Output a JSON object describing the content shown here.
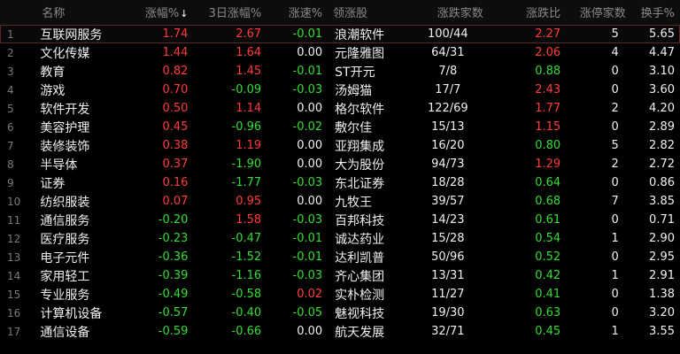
{
  "header": {
    "name": "名称",
    "pct": "涨幅%",
    "sort_arrow": "↓",
    "pct3d": "3日涨幅%",
    "speed": "涨速%",
    "lead": "领涨股",
    "updown": "涨跌家数",
    "ratio": "涨跌比",
    "limit": "涨停家数",
    "turnover": "换手%"
  },
  "colors": {
    "up": "#ff3b3b",
    "down": "#33dd33",
    "flat": "#f0f0f0"
  },
  "rows": [
    {
      "idx": "1",
      "name": "互联网服务",
      "pct": "1.74",
      "pct3d": "2.67",
      "speed": "-0.01",
      "lead": "浪潮软件",
      "updown": "100/44",
      "ratio": "2.27",
      "limit": "5",
      "turnover": "5.65"
    },
    {
      "idx": "2",
      "name": "文化传媒",
      "pct": "1.44",
      "pct3d": "1.64",
      "speed": "0.00",
      "lead": "元隆雅图",
      "updown": "64/31",
      "ratio": "2.06",
      "limit": "4",
      "turnover": "4.47"
    },
    {
      "idx": "3",
      "name": "教育",
      "pct": "0.82",
      "pct3d": "1.45",
      "speed": "-0.01",
      "lead": "ST开元",
      "updown": "7/8",
      "ratio": "0.88",
      "limit": "0",
      "turnover": "3.10"
    },
    {
      "idx": "4",
      "name": "游戏",
      "pct": "0.70",
      "pct3d": "-0.09",
      "speed": "-0.03",
      "lead": "汤姆猫",
      "updown": "17/7",
      "ratio": "2.43",
      "limit": "0",
      "turnover": "3.60"
    },
    {
      "idx": "5",
      "name": "软件开发",
      "pct": "0.50",
      "pct3d": "1.14",
      "speed": "0.00",
      "lead": "格尔软件",
      "updown": "122/69",
      "ratio": "1.77",
      "limit": "2",
      "turnover": "4.20"
    },
    {
      "idx": "6",
      "name": "美容护理",
      "pct": "0.45",
      "pct3d": "-0.96",
      "speed": "-0.02",
      "lead": "敷尔佳",
      "updown": "15/13",
      "ratio": "1.15",
      "limit": "0",
      "turnover": "2.89"
    },
    {
      "idx": "7",
      "name": "装修装饰",
      "pct": "0.38",
      "pct3d": "1.19",
      "speed": "0.00",
      "lead": "亚翔集成",
      "updown": "16/20",
      "ratio": "0.80",
      "limit": "5",
      "turnover": "2.82"
    },
    {
      "idx": "8",
      "name": "半导体",
      "pct": "0.37",
      "pct3d": "-1.90",
      "speed": "0.00",
      "lead": "大为股份",
      "updown": "94/73",
      "ratio": "1.29",
      "limit": "2",
      "turnover": "2.72"
    },
    {
      "idx": "9",
      "name": "证券",
      "pct": "0.16",
      "pct3d": "-1.77",
      "speed": "-0.03",
      "lead": "东北证券",
      "updown": "18/28",
      "ratio": "0.64",
      "limit": "0",
      "turnover": "0.86"
    },
    {
      "idx": "10",
      "name": "纺织服装",
      "pct": "0.07",
      "pct3d": "0.95",
      "speed": "0.00",
      "lead": "九牧王",
      "updown": "39/57",
      "ratio": "0.68",
      "limit": "7",
      "turnover": "3.85"
    },
    {
      "idx": "11",
      "name": "通信服务",
      "pct": "-0.20",
      "pct3d": "1.58",
      "speed": "-0.03",
      "lead": "百邦科技",
      "updown": "14/23",
      "ratio": "0.61",
      "limit": "0",
      "turnover": "0.71"
    },
    {
      "idx": "12",
      "name": "医疗服务",
      "pct": "-0.23",
      "pct3d": "-0.47",
      "speed": "-0.01",
      "lead": "诚达药业",
      "updown": "15/28",
      "ratio": "0.54",
      "limit": "1",
      "turnover": "2.90"
    },
    {
      "idx": "13",
      "name": "电子元件",
      "pct": "-0.36",
      "pct3d": "-1.52",
      "speed": "-0.01",
      "lead": "达利凯普",
      "updown": "50/96",
      "ratio": "0.52",
      "limit": "0",
      "turnover": "2.95"
    },
    {
      "idx": "14",
      "name": "家用轻工",
      "pct": "-0.39",
      "pct3d": "-1.16",
      "speed": "-0.03",
      "lead": "齐心集团",
      "updown": "13/31",
      "ratio": "0.42",
      "limit": "1",
      "turnover": "2.91"
    },
    {
      "idx": "15",
      "name": "专业服务",
      "pct": "-0.49",
      "pct3d": "-0.58",
      "speed": "0.02",
      "lead": "实朴检测",
      "updown": "11/27",
      "ratio": "0.41",
      "limit": "0",
      "turnover": "1.38"
    },
    {
      "idx": "16",
      "name": "计算机设备",
      "pct": "-0.57",
      "pct3d": "-0.40",
      "speed": "-0.05",
      "lead": "魅视科技",
      "updown": "19/30",
      "ratio": "0.63",
      "limit": "0",
      "turnover": "3.20"
    },
    {
      "idx": "17",
      "name": "通信设备",
      "pct": "-0.59",
      "pct3d": "-0.66",
      "speed": "0.00",
      "lead": "航天发展",
      "updown": "32/71",
      "ratio": "0.45",
      "limit": "1",
      "turnover": "3.55"
    }
  ]
}
